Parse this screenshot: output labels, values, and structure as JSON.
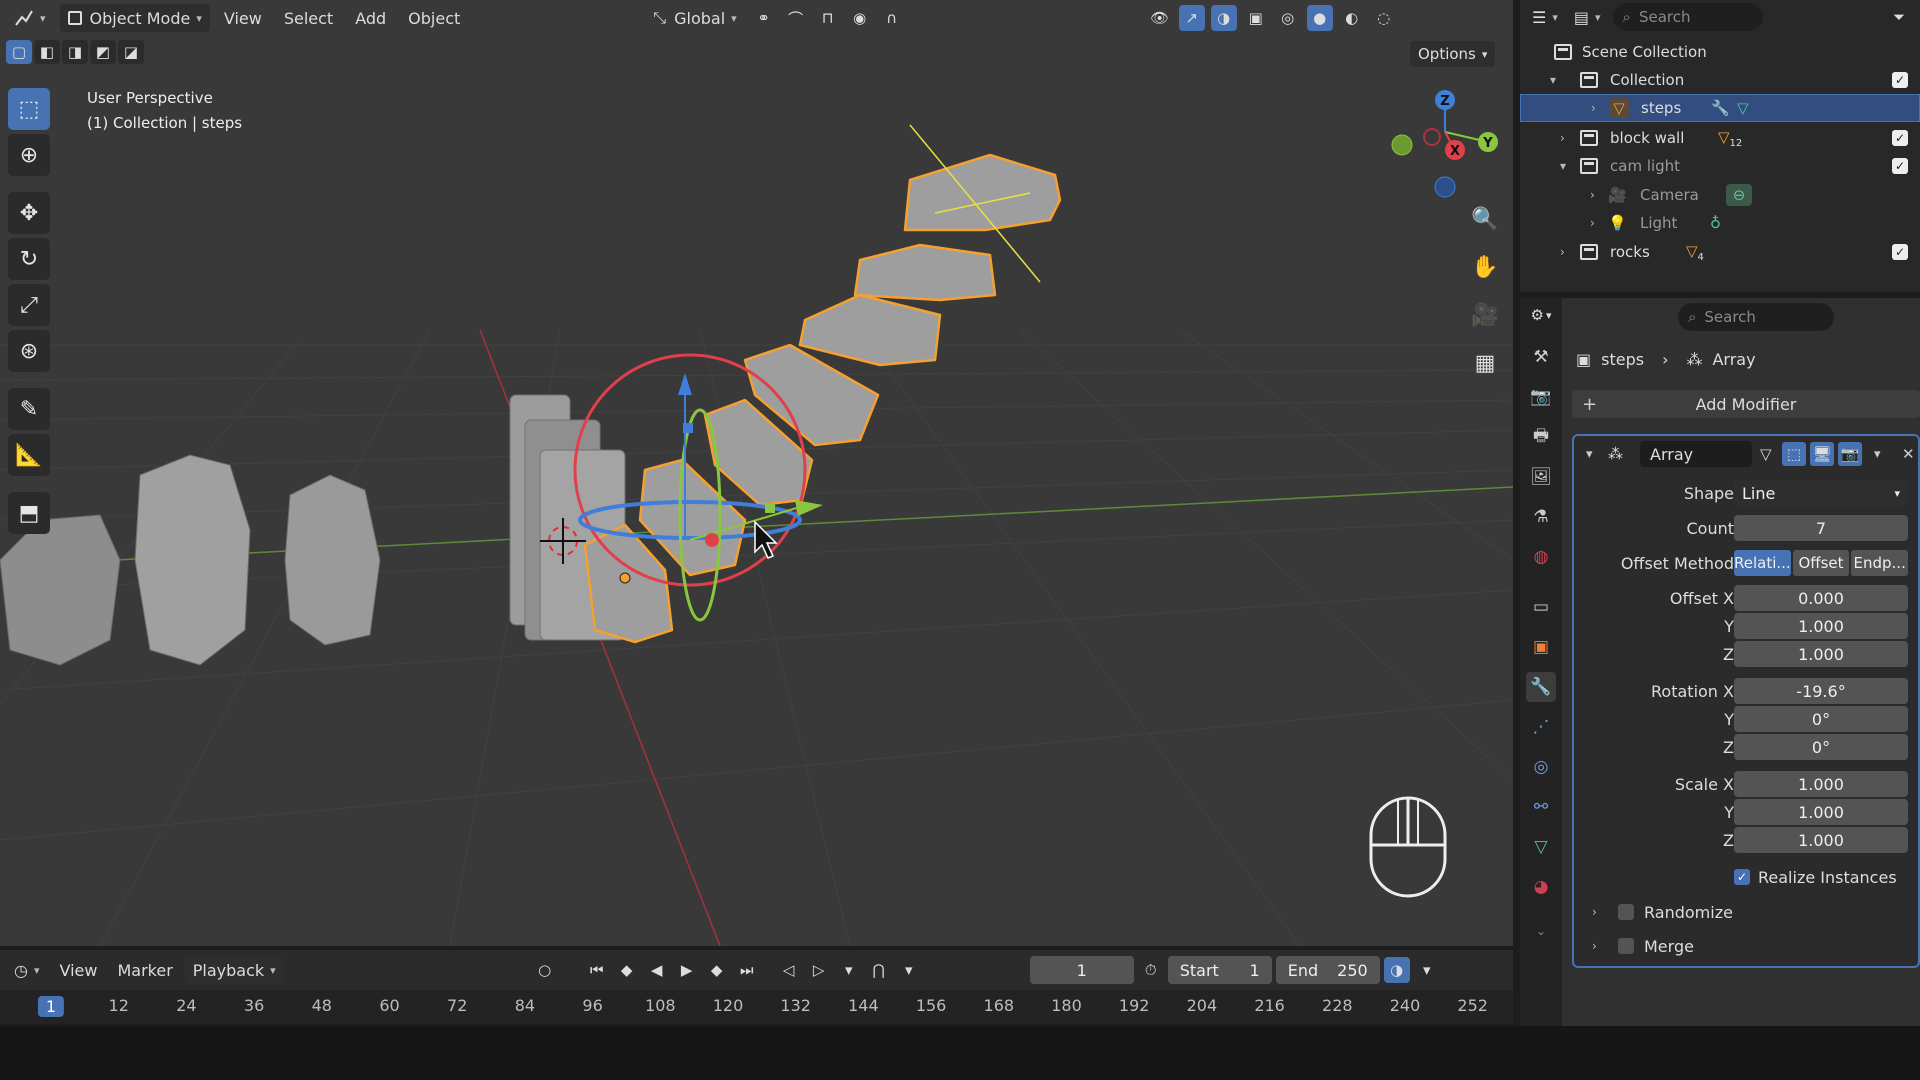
{
  "viewport": {
    "mode": "Object Mode",
    "menus": [
      "View",
      "Select",
      "Add",
      "Object"
    ],
    "transform_orientation": "Global",
    "options_label": "Options",
    "overlay_title": "User Perspective",
    "overlay_context": "(1) Collection | steps",
    "axis_labels": {
      "z": "Z",
      "y": "Y",
      "x": "X"
    }
  },
  "timeline": {
    "menus": [
      "View",
      "Marker",
      "Playback"
    ],
    "current_frame": "1",
    "start_label": "Start",
    "start_value": "1",
    "end_label": "End",
    "end_value": "250",
    "ticks": [
      "1",
      "12",
      "24",
      "36",
      "48",
      "60",
      "72",
      "84",
      "96",
      "108",
      "120",
      "132",
      "144",
      "156",
      "168",
      "180",
      "192",
      "204",
      "216",
      "228",
      "240",
      "252"
    ]
  },
  "outliner": {
    "search_placeholder": "Search",
    "rows": [
      {
        "label": "Scene Collection"
      },
      {
        "label": "Collection"
      },
      {
        "label": "steps"
      },
      {
        "label": "block wall",
        "badge": "12"
      },
      {
        "label": "cam light"
      },
      {
        "label": "Camera"
      },
      {
        "label": "Light"
      },
      {
        "label": "rocks",
        "badge": "4"
      }
    ]
  },
  "properties": {
    "search_placeholder": "Search",
    "breadcrumb": {
      "object": "steps",
      "modifier": "Array"
    },
    "add_modifier": "Add Modifier",
    "modifier": {
      "name": "Array",
      "shape_label": "Shape",
      "shape_value": "Line",
      "count_label": "Count",
      "count_value": "7",
      "offset_method_label": "Offset Method",
      "offset_methods": [
        "Relati...",
        "Offset",
        "Endp..."
      ],
      "offset_x_label": "Offset X",
      "offset_x": "0.000",
      "offset_y_label": "Y",
      "offset_y": "1.000",
      "offset_z_label": "Z",
      "offset_z": "1.000",
      "rotation_x_label": "Rotation X",
      "rotation_x": "-19.6°",
      "rotation_y_label": "Y",
      "rotation_y": "0°",
      "rotation_z_label": "Z",
      "rotation_z": "0°",
      "scale_x_label": "Scale X",
      "scale_x": "1.000",
      "scale_y_label": "Y",
      "scale_y": "1.000",
      "scale_z_label": "Z",
      "scale_z": "1.000",
      "realize_instances": "Realize Instances",
      "randomize": "Randomize",
      "merge": "Merge"
    }
  },
  "colors": {
    "accent": "#4772b3",
    "selection_orange": "#f5a030",
    "axis_x": "#e0404a",
    "axis_y": "#8ac640",
    "axis_z": "#3f7fd9"
  }
}
